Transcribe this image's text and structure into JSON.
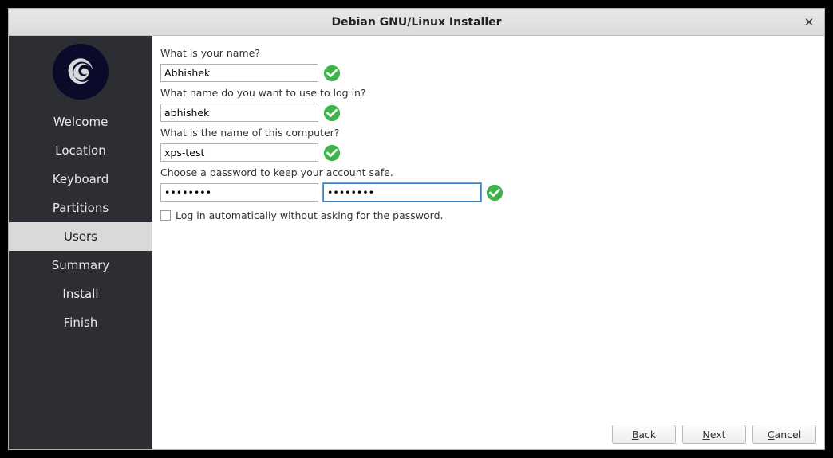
{
  "window": {
    "title": "Debian GNU/Linux Installer"
  },
  "sidebar": {
    "items": [
      {
        "label": "Welcome"
      },
      {
        "label": "Location"
      },
      {
        "label": "Keyboard"
      },
      {
        "label": "Partitions"
      },
      {
        "label": "Users"
      },
      {
        "label": "Summary"
      },
      {
        "label": "Install"
      },
      {
        "label": "Finish"
      }
    ],
    "active_index": 4
  },
  "form": {
    "name_label": "What is your name?",
    "name_value": "Abhishek",
    "username_label": "What name do you want to use to log in?",
    "username_value": "abhishek",
    "hostname_label": "What is the name of this computer?",
    "hostname_value": "xps-test",
    "password_label": "Choose a password to keep your account safe.",
    "password_value": "••••••••",
    "password_confirm_value": "••••••••",
    "autologin_label": "Log in automatically without asking for the password.",
    "autologin_checked": false
  },
  "footer": {
    "back_mnemonic": "B",
    "back_rest": "ack",
    "next_mnemonic": "N",
    "next_rest": "ext",
    "cancel_mnemonic": "C",
    "cancel_rest": "ancel"
  },
  "colors": {
    "sidebar_bg": "#2c2e33",
    "active_bg": "#d9d9d9",
    "check_green": "#3fb44a"
  }
}
